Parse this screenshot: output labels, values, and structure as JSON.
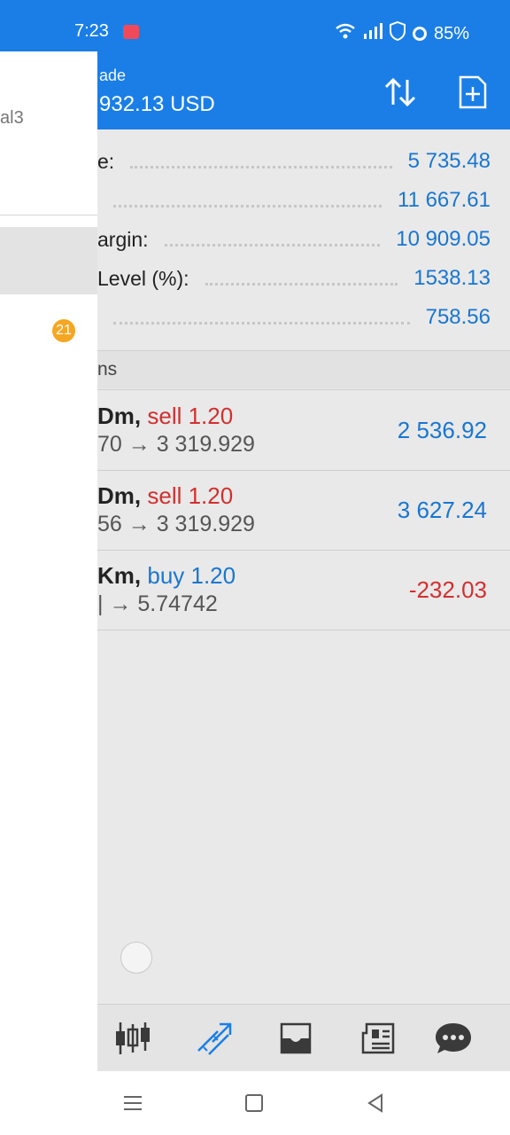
{
  "status_bar": {
    "time": "7:23",
    "battery": "85%",
    "icons": [
      "screen-record-icon",
      "wifi-icon",
      "signal-icon",
      "shield-icon",
      "battery-icon"
    ]
  },
  "app_bar": {
    "subtitle": "ade",
    "balance": "932.13 USD",
    "icons": [
      "sort-icon",
      "new-order-icon"
    ]
  },
  "account": {
    "rows": [
      {
        "label": "e:",
        "value": "5 735.48"
      },
      {
        "label": "",
        "value": "11 667.61"
      },
      {
        "label": "argin:",
        "value": "10 909.05"
      },
      {
        "label": "Level (%):",
        "value": "1538.13"
      },
      {
        "label": "",
        "value": "758.56"
      }
    ]
  },
  "positions_header": "ns",
  "positions": [
    {
      "symbol": "Dm,",
      "side": "sell 1.20",
      "prices": "70 → 3 319.929",
      "profit": "2 536.92",
      "negative": false
    },
    {
      "symbol": "Dm,",
      "side": "sell 1.20",
      "prices": "56 → 3 319.929",
      "profit": "3 627.24",
      "negative": false
    },
    {
      "symbol": "Km,",
      "side": "buy 1.20",
      "prices": "| → 5.74742",
      "profit": "-232.03",
      "negative": true
    }
  ],
  "bottom_nav": [
    "quotes-icon",
    "trade-icon",
    "history-icon",
    "news-icon",
    "chat-icon"
  ],
  "drawer": {
    "account_suffix": "al3",
    "badge_count": "21"
  },
  "colors": {
    "accent": "#1a7ee6",
    "positive": "#1976d2",
    "negative": "#d32f2f",
    "badge": "#f5a623"
  }
}
